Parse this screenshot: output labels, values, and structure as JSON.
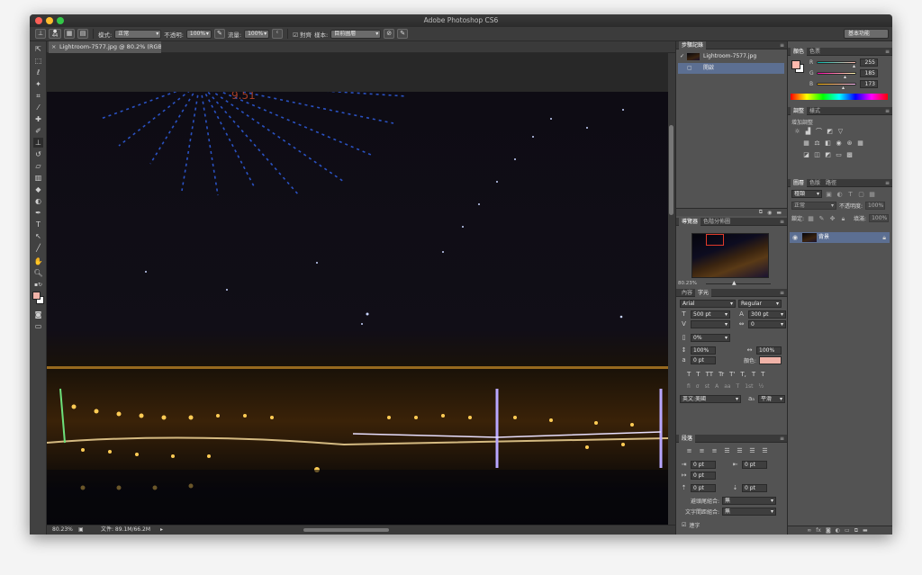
{
  "window": {
    "title": "Adobe Photoshop CS6"
  },
  "options_bar": {
    "brush_size": "44",
    "mode_label": "模式:",
    "mode_value": "正常",
    "opacity_label": "不透明:",
    "opacity_value": "100%",
    "flow_label": "流量:",
    "flow_value": "100%",
    "aligned_label": "對齊",
    "sample_label": "樣本:",
    "sample_value": "目前圖層",
    "workspace": "基本功能"
  },
  "document": {
    "tab_title": "Lightroom-7577.jpg @ 80.2% (RGB/8)",
    "close_glyph": "×"
  },
  "statusbar": {
    "zoom": "80.23%",
    "doc_info": "文件: 89.1M/66.2M"
  },
  "history_panel": {
    "tabs": [
      "步驟記錄"
    ],
    "snapshot": "Lightroom-7577.jpg",
    "items": [
      "開啟"
    ]
  },
  "navigator_panel": {
    "tabs": [
      "導覽器",
      "色階分佈圖"
    ],
    "zoom": "80.23%"
  },
  "character_panel": {
    "tabs": [
      "內容",
      "字元"
    ],
    "font_family": "Arial",
    "font_style": "Regular",
    "size": "500 pt",
    "leading": "300 pt",
    "kerning": "",
    "tracking": "0",
    "vscale_pct": "0%",
    "vertical_scale": "100%",
    "horizontal_scale": "100%",
    "baseline": "0 pt",
    "color_label": "顏色:",
    "color": "#f0b3a8",
    "language": "英文:美國",
    "aa_mode": "平滑",
    "style_buttons": [
      "T",
      "T",
      "TT",
      "Tr",
      "T'",
      "T,",
      "T",
      "T"
    ],
    "ot_buttons": [
      "fi",
      "σ",
      "st",
      "A",
      "aa",
      "T",
      "1st",
      "½"
    ]
  },
  "paragraph_panel": {
    "tabs": [
      "段落"
    ],
    "indent_left": "0 pt",
    "indent_right": "0 pt",
    "indent_first": "0 pt",
    "space_before": "0 pt",
    "space_after": "0 pt",
    "kinsoku_label": "避頭尾組合:",
    "kinsoku_value": "無",
    "mojikumi_label": "文字間距組合:",
    "mojikumi_value": "無",
    "hyphenate_label": "連字"
  },
  "color_panel": {
    "tabs": [
      "顏色",
      "色票"
    ],
    "r": "255",
    "g": "185",
    "b": "173",
    "fg": "#ffb9ad",
    "bg": "#ffffff"
  },
  "adjustments_panel": {
    "tabs": [
      "調整",
      "樣式"
    ],
    "label": "增加調整"
  },
  "layers_panel": {
    "tabs": [
      "圖層",
      "色版",
      "路徑"
    ],
    "filter": "種類",
    "blend_mode": "正常",
    "opacity_label": "不透明度:",
    "opacity": "100%",
    "lock_label": "鎖定:",
    "fill_label": "填滿:",
    "fill": "100%",
    "layer_name": "背景"
  }
}
